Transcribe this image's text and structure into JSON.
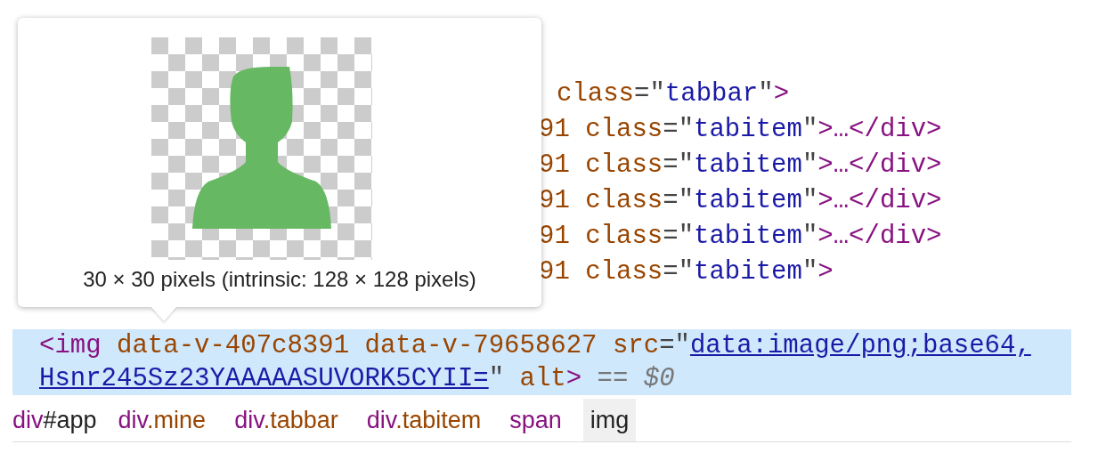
{
  "code_lines": [
    {
      "tokens": [
        {
          "kind": "attr",
          "text": "class"
        },
        {
          "kind": "punct",
          "text": "=\""
        },
        {
          "kind": "value",
          "text": "tabbar"
        },
        {
          "kind": "punct",
          "text": "\""
        },
        {
          "kind": "tag",
          "text": ">"
        }
      ]
    },
    {
      "tokens": [
        {
          "kind": "attr",
          "text": "91 class"
        },
        {
          "kind": "punct",
          "text": "=\""
        },
        {
          "kind": "value",
          "text": "tabitem"
        },
        {
          "kind": "punct",
          "text": "\""
        },
        {
          "kind": "tag",
          "text": ">…</div>"
        }
      ]
    },
    {
      "tokens": [
        {
          "kind": "attr",
          "text": "91 class"
        },
        {
          "kind": "punct",
          "text": "=\""
        },
        {
          "kind": "value",
          "text": "tabitem"
        },
        {
          "kind": "punct",
          "text": "\""
        },
        {
          "kind": "tag",
          "text": ">…</div>"
        }
      ]
    },
    {
      "tokens": [
        {
          "kind": "attr",
          "text": "91 class"
        },
        {
          "kind": "punct",
          "text": "=\""
        },
        {
          "kind": "value",
          "text": "tabitem"
        },
        {
          "kind": "punct",
          "text": "\""
        },
        {
          "kind": "tag",
          "text": ">…</div>"
        }
      ]
    },
    {
      "tokens": [
        {
          "kind": "attr",
          "text": "91 class"
        },
        {
          "kind": "punct",
          "text": "=\""
        },
        {
          "kind": "value",
          "text": "tabitem"
        },
        {
          "kind": "punct",
          "text": "\""
        },
        {
          "kind": "tag",
          "text": ">…</div>"
        }
      ]
    },
    {
      "tokens": [
        {
          "kind": "attr",
          "text": "91 class"
        },
        {
          "kind": "punct",
          "text": "=\""
        },
        {
          "kind": "value",
          "text": "tabitem"
        },
        {
          "kind": "punct",
          "text": "\""
        },
        {
          "kind": "tag",
          "text": ">"
        }
      ]
    }
  ],
  "selected_node": {
    "selected": true,
    "lines": [
      {
        "tokens": [
          {
            "kind": "tag",
            "text": "<img"
          },
          {
            "kind": "attr",
            "text": " data-v-407c8391 data-v-79658627 src"
          },
          {
            "kind": "punct",
            "text": "=\""
          },
          {
            "kind": "link",
            "text": "data:image/png;base64,"
          }
        ]
      },
      {
        "tokens": [
          {
            "kind": "link",
            "text": "Hsnr245Sz23YAAAAASUVORK5CYII="
          },
          {
            "kind": "punct",
            "text": "\""
          },
          {
            "kind": "attr",
            "text": " alt"
          },
          {
            "kind": "tag",
            "text": ">"
          },
          {
            "kind": "muted",
            "text": " == "
          },
          {
            "kind": "var",
            "text": "$0"
          }
        ]
      }
    ]
  },
  "tooltip": {
    "caption": "30 × 30 pixels (intrinsic: 128 × 128 pixels)"
  },
  "breadcrumbs": [
    {
      "selected": false,
      "parts": [
        {
          "kind": "tag",
          "text": "div"
        },
        {
          "kind": "id",
          "text": "#app"
        }
      ]
    },
    {
      "selected": false,
      "parts": [
        {
          "kind": "tag",
          "text": "div"
        },
        {
          "kind": "class",
          "text": ".mine"
        }
      ]
    },
    {
      "selected": false,
      "parts": [
        {
          "kind": "tag",
          "text": "div"
        },
        {
          "kind": "class",
          "text": ".tabbar"
        }
      ]
    },
    {
      "selected": false,
      "parts": [
        {
          "kind": "tag",
          "text": "div"
        },
        {
          "kind": "class",
          "text": ".tabitem"
        }
      ]
    },
    {
      "selected": false,
      "parts": [
        {
          "kind": "tag",
          "text": "span"
        }
      ]
    },
    {
      "selected": true,
      "parts": [
        {
          "kind": "tag",
          "text": "img"
        }
      ]
    }
  ]
}
